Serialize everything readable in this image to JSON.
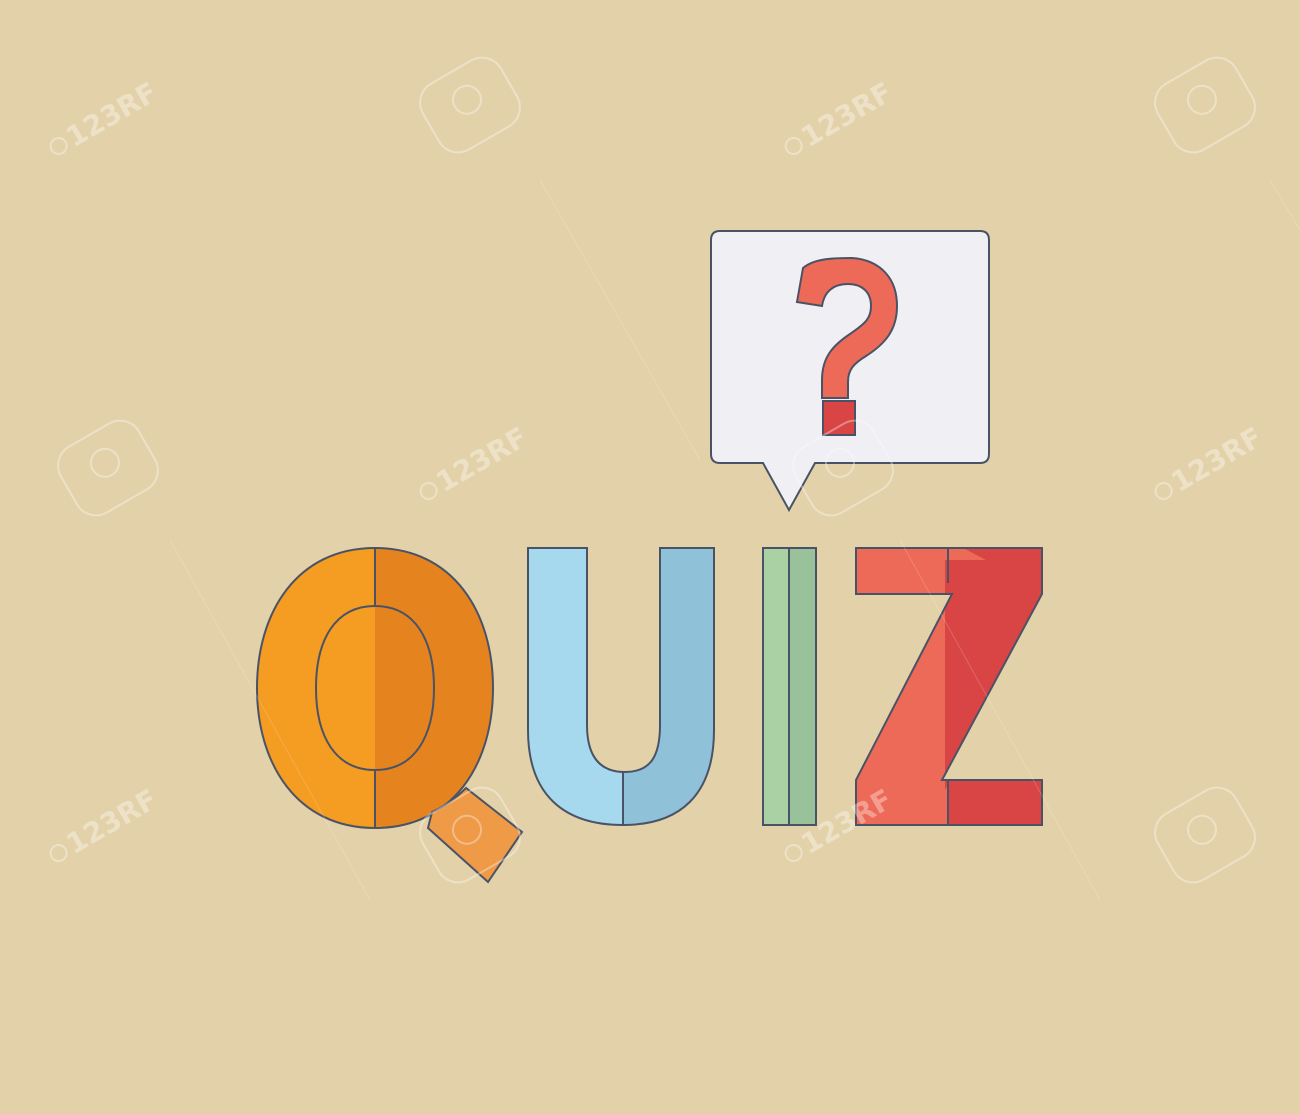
{
  "word": {
    "text": "QUIZ",
    "letters": [
      "Q",
      "U",
      "I",
      "Z"
    ]
  },
  "bubble": {
    "symbol": "?"
  },
  "watermark": {
    "text": "123RF"
  },
  "colors": {
    "background": "#E3D2A9",
    "outline": "#4A5366",
    "q_light": "#F59C22",
    "q_dark": "#E5841F",
    "q_tail": "#EE9A47",
    "u_light": "#A7D9EE",
    "u_dark": "#8FC1D8",
    "i_light": "#AAD1A4",
    "i_dark": "#99C29A",
    "z_light": "#EE6A58",
    "z_dark": "#D94545",
    "bubble_fill": "#EFEFF4",
    "question_mark": "#EE6A58",
    "question_dot": "#D94545",
    "watermark": "#FFFFFF"
  }
}
